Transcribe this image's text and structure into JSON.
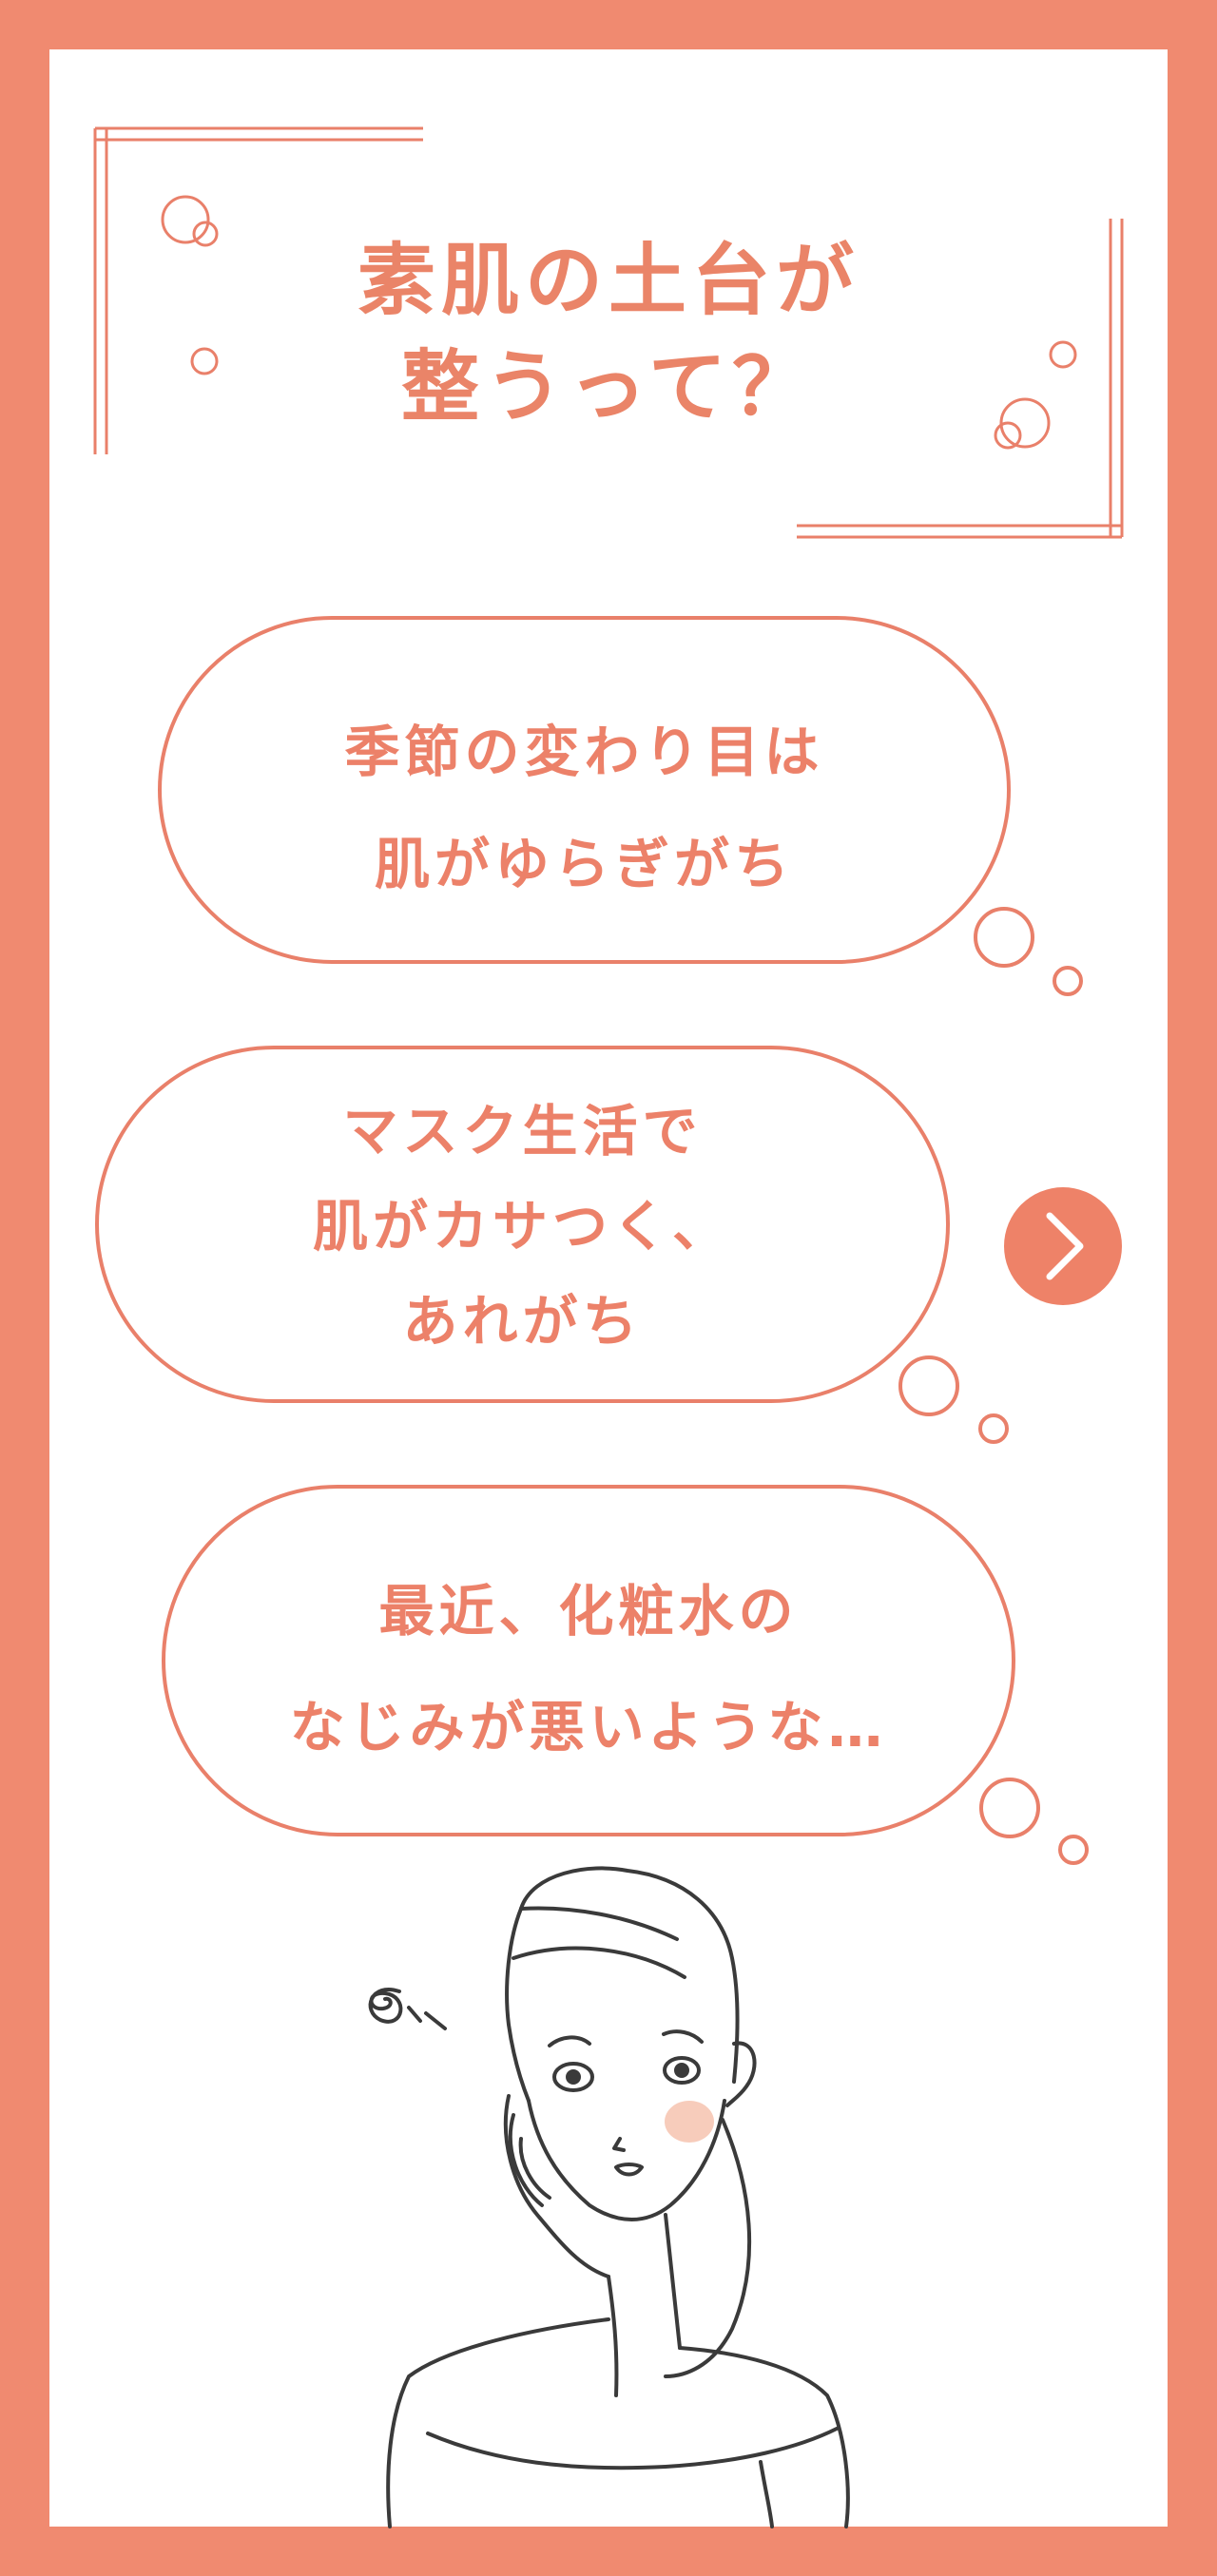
{
  "header": {
    "title_line1": "素肌の土台が",
    "title_line2": "整うって？"
  },
  "bubbles": [
    {
      "line1": "季節の変わり目は",
      "line2": "肌がゆらぎがち"
    },
    {
      "line1": "マスク生活で",
      "line2": "肌がカサつく、",
      "line3": "あれがち"
    },
    {
      "line1": "最近、化粧水の",
      "line2": "なじみが悪いような…"
    }
  ],
  "icons": {
    "next": "chevron-right-icon",
    "illustration": "worried-woman-illustration"
  },
  "colors": {
    "frame": "#F08A70",
    "accent": "#EC8169",
    "line": "#E9806A"
  }
}
